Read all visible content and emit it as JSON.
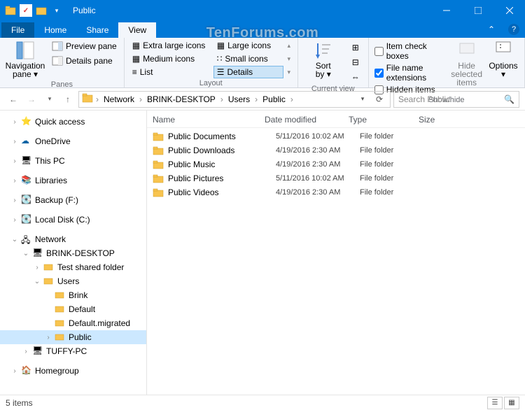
{
  "window": {
    "title": "Public"
  },
  "tabs": {
    "file": "File",
    "home": "Home",
    "share": "Share",
    "view": "View"
  },
  "ribbon": {
    "panes": {
      "nav": "Navigation\npane ▾",
      "preview": "Preview pane",
      "details": "Details pane",
      "label": "Panes"
    },
    "layout": {
      "xl": "Extra large icons",
      "l": "Large icons",
      "m": "Medium icons",
      "s": "Small icons",
      "list": "List",
      "details": "Details",
      "label": "Layout"
    },
    "current": {
      "sort": "Sort\nby ▾",
      "label": "Current view"
    },
    "show": {
      "checkboxes": "Item check boxes",
      "ext": "File name extensions",
      "hidden": "Hidden items",
      "hide": "Hide selected\nitems",
      "options": "Options\n▾",
      "label": "Show/hide"
    }
  },
  "breadcrumbs": [
    "Network",
    "BRINK-DESKTOP",
    "Users",
    "Public"
  ],
  "search": {
    "placeholder": "Search Public"
  },
  "tree": {
    "quick": "Quick access",
    "onedrive": "OneDrive",
    "thispc": "This PC",
    "libraries": "Libraries",
    "backup": "Backup (F:)",
    "localdisk": "Local Disk (C:)",
    "network": "Network",
    "brink": "BRINK-DESKTOP",
    "testshare": "Test shared folder",
    "users": "Users",
    "u_brink": "Brink",
    "u_default": "Default",
    "u_defaultm": "Default.migrated",
    "u_public": "Public",
    "tuffy": "TUFFY-PC",
    "homegroup": "Homegroup"
  },
  "columns": {
    "name": "Name",
    "date": "Date modified",
    "type": "Type",
    "size": "Size"
  },
  "rows": [
    {
      "name": "Public Documents",
      "date": "5/11/2016 10:02 AM",
      "type": "File folder"
    },
    {
      "name": "Public Downloads",
      "date": "4/19/2016 2:30 AM",
      "type": "File folder"
    },
    {
      "name": "Public Music",
      "date": "4/19/2016 2:30 AM",
      "type": "File folder"
    },
    {
      "name": "Public Pictures",
      "date": "5/11/2016 10:02 AM",
      "type": "File folder"
    },
    {
      "name": "Public Videos",
      "date": "4/19/2016 2:30 AM",
      "type": "File folder"
    }
  ],
  "status": {
    "count": "5 items"
  },
  "watermark": "TenForums.com"
}
